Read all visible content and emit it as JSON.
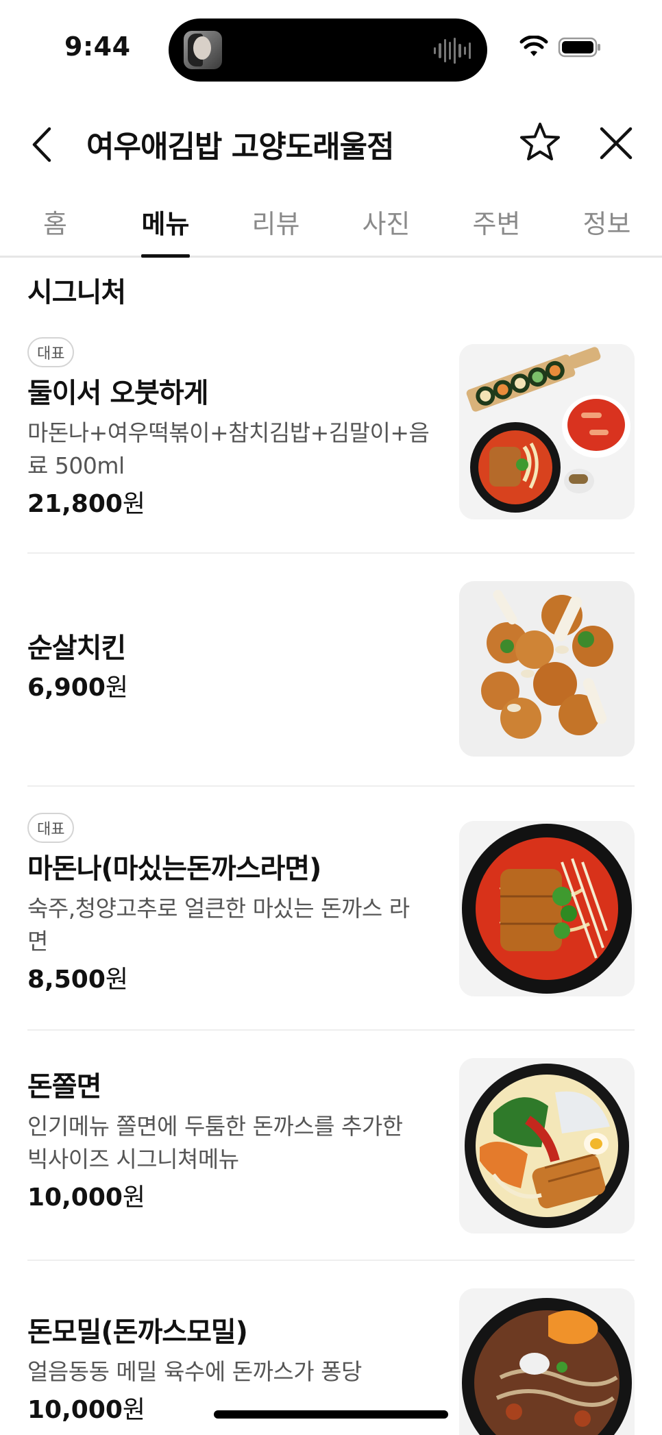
{
  "status_bar": {
    "time": "9:44"
  },
  "header": {
    "title": "여우애김밥 고양도래울점"
  },
  "tabs": [
    {
      "label": "홈",
      "active": false
    },
    {
      "label": "메뉴",
      "active": true
    },
    {
      "label": "리뷰",
      "active": false
    },
    {
      "label": "사진",
      "active": false
    },
    {
      "label": "주변",
      "active": false
    },
    {
      "label": "정보",
      "active": false
    }
  ],
  "section": {
    "title": "시그니처"
  },
  "menu_items": [
    {
      "badge": "대표",
      "name": "둘이서 오붓하게",
      "desc_line1": "마돈나+여우떡볶이+참치김밥+김말이+음",
      "desc_line2": "료 500ml",
      "price": "21,800",
      "currency": "원",
      "image_icon": "combo-set-image"
    },
    {
      "badge": "",
      "name": "순살치킨",
      "desc_line1": "",
      "desc_line2": "",
      "price": "6,900",
      "currency": "원",
      "image_icon": "chicken-image"
    },
    {
      "badge": "대표",
      "name": "마돈나(마싰는돈까스라면)",
      "desc_line1": "숙주,청양고추로 얼큰한 마싰는 돈까스 라",
      "desc_line2": "면",
      "price": "8,500",
      "currency": "원",
      "image_icon": "ramen-image"
    },
    {
      "badge": "",
      "name": "돈쫄면",
      "desc_line1": "인기메뉴 쫄면에 두툼한 돈까스를 추가한",
      "desc_line2": "빅사이즈 시그니쳐메뉴",
      "price": "10,000",
      "currency": "원",
      "image_icon": "jjolmyeon-image"
    },
    {
      "badge": "",
      "name": "돈모밀(돈까스모밀)",
      "desc_line1": "얼음동동 메밀 육수에 돈까스가 퐁당",
      "desc_line2": "",
      "price": "10,000",
      "currency": "원",
      "image_icon": "soba-image"
    }
  ],
  "colors": {
    "text": "#111111",
    "muted": "#8a8a8a",
    "divider": "#eeeeee",
    "thumb_bg": "#f3f3f3"
  }
}
